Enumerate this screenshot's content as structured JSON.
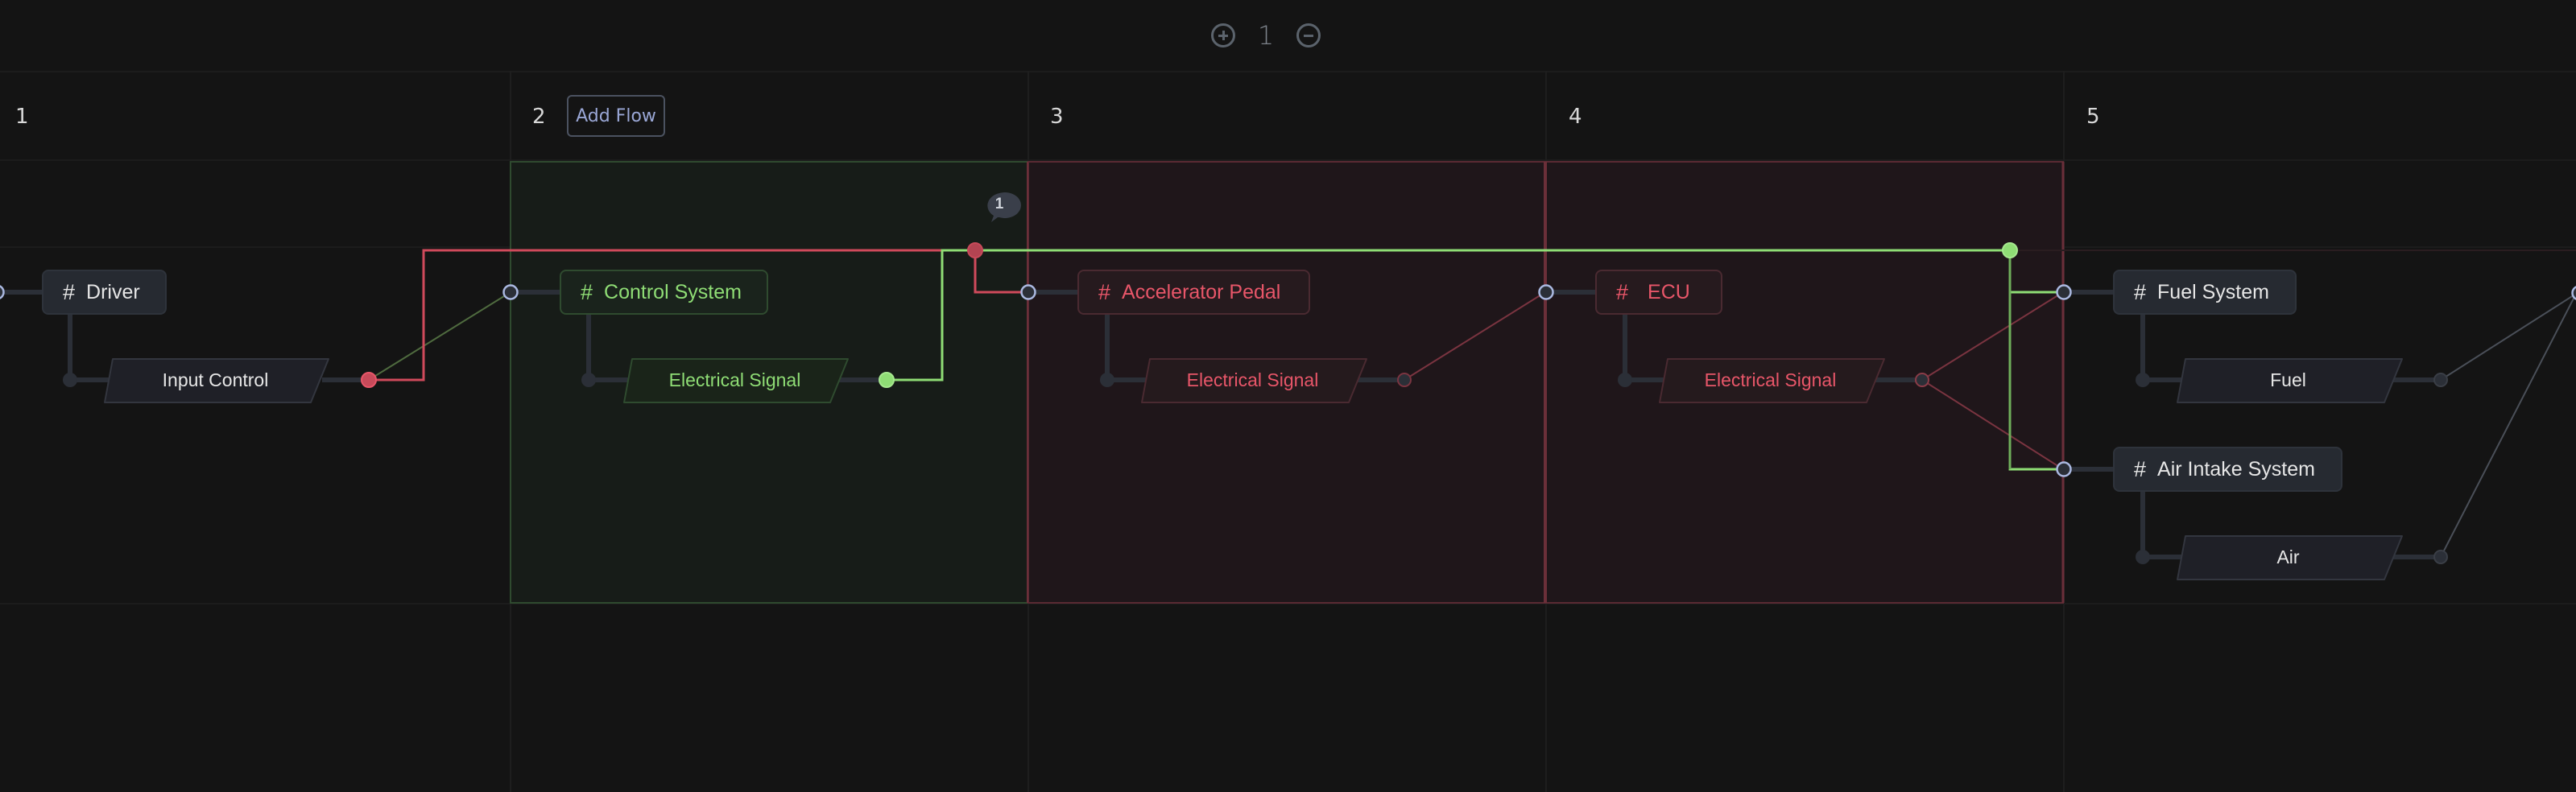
{
  "toolbar": {
    "zoom_in_icon": "plus-circle-icon",
    "zoom_level": "1",
    "zoom_out_icon": "minus-circle-icon"
  },
  "columns": [
    {
      "number": "1"
    },
    {
      "number": "2",
      "action_label": "Add Flow"
    },
    {
      "number": "3"
    },
    {
      "number": "4"
    },
    {
      "number": "5"
    }
  ],
  "highlight_regions": [
    {
      "columns": [
        "2"
      ],
      "status": "success",
      "color": "#8fdd75"
    },
    {
      "columns": [
        "3",
        "4"
      ],
      "status": "error",
      "color": "#e85669"
    }
  ],
  "components": [
    {
      "id": "driver",
      "label": "Driver",
      "column": "1",
      "status": "neutral",
      "icon": "hash-icon",
      "output": "Input Control",
      "output_status": "error"
    },
    {
      "id": "control-system",
      "label": "Control System",
      "column": "2",
      "status": "success",
      "icon": "hash-icon",
      "output": "Electrical Signal",
      "output_status": "success"
    },
    {
      "id": "accelerator-pedal",
      "label": "Accelerator Pedal",
      "column": "3",
      "status": "error",
      "icon": "hash-icon",
      "output": "Electrical Signal",
      "output_status": "error"
    },
    {
      "id": "ecu",
      "label": "ECU",
      "column": "4",
      "status": "error",
      "icon": "hash-icon",
      "output": "Electrical Signal",
      "output_status": "error"
    },
    {
      "id": "fuel-system",
      "label": "Fuel System",
      "column": "5",
      "status": "neutral",
      "icon": "hash-icon",
      "output": "Fuel",
      "output_status": "neutral"
    },
    {
      "id": "air-intake-system",
      "label": "Air Intake System",
      "column": "5",
      "status": "neutral",
      "icon": "hash-icon",
      "output": "Air",
      "output_status": "neutral"
    }
  ],
  "comment_badge": {
    "icon": "comment-bubble-icon",
    "count": "1"
  },
  "colors": {
    "background": "#141414",
    "success": "#8fdd75",
    "error": "#e85669",
    "port": "#aab8e0",
    "neutral_text": "#e6e6e6",
    "add_flow_text": "#9aa7d6"
  }
}
